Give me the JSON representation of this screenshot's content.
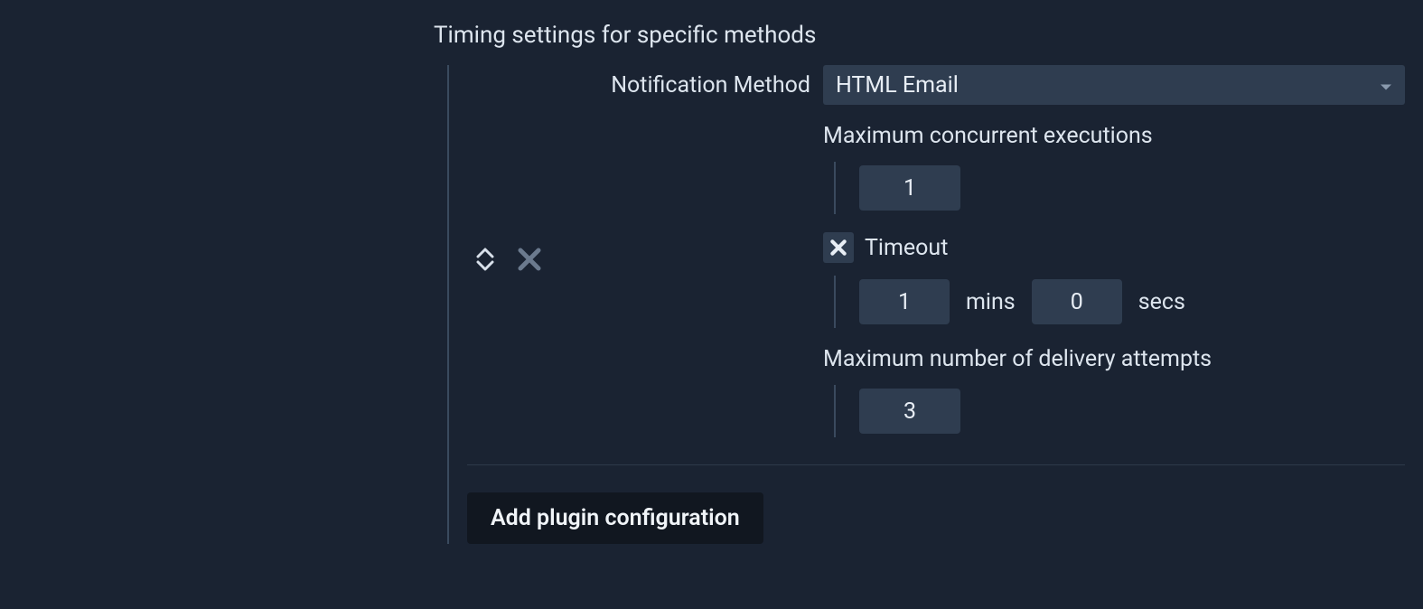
{
  "section": {
    "title": "Timing settings for specific methods"
  },
  "method": {
    "label": "Notification Method",
    "selected": "HTML Email"
  },
  "max_concurrent": {
    "label": "Maximum concurrent executions",
    "value": "1"
  },
  "timeout": {
    "label": "Timeout",
    "checked": true,
    "mins": "1",
    "mins_unit": "mins",
    "secs": "0",
    "secs_unit": "secs"
  },
  "max_attempts": {
    "label": "Maximum number of delivery attempts",
    "value": "3"
  },
  "actions": {
    "add_plugin": "Add plugin configuration"
  }
}
